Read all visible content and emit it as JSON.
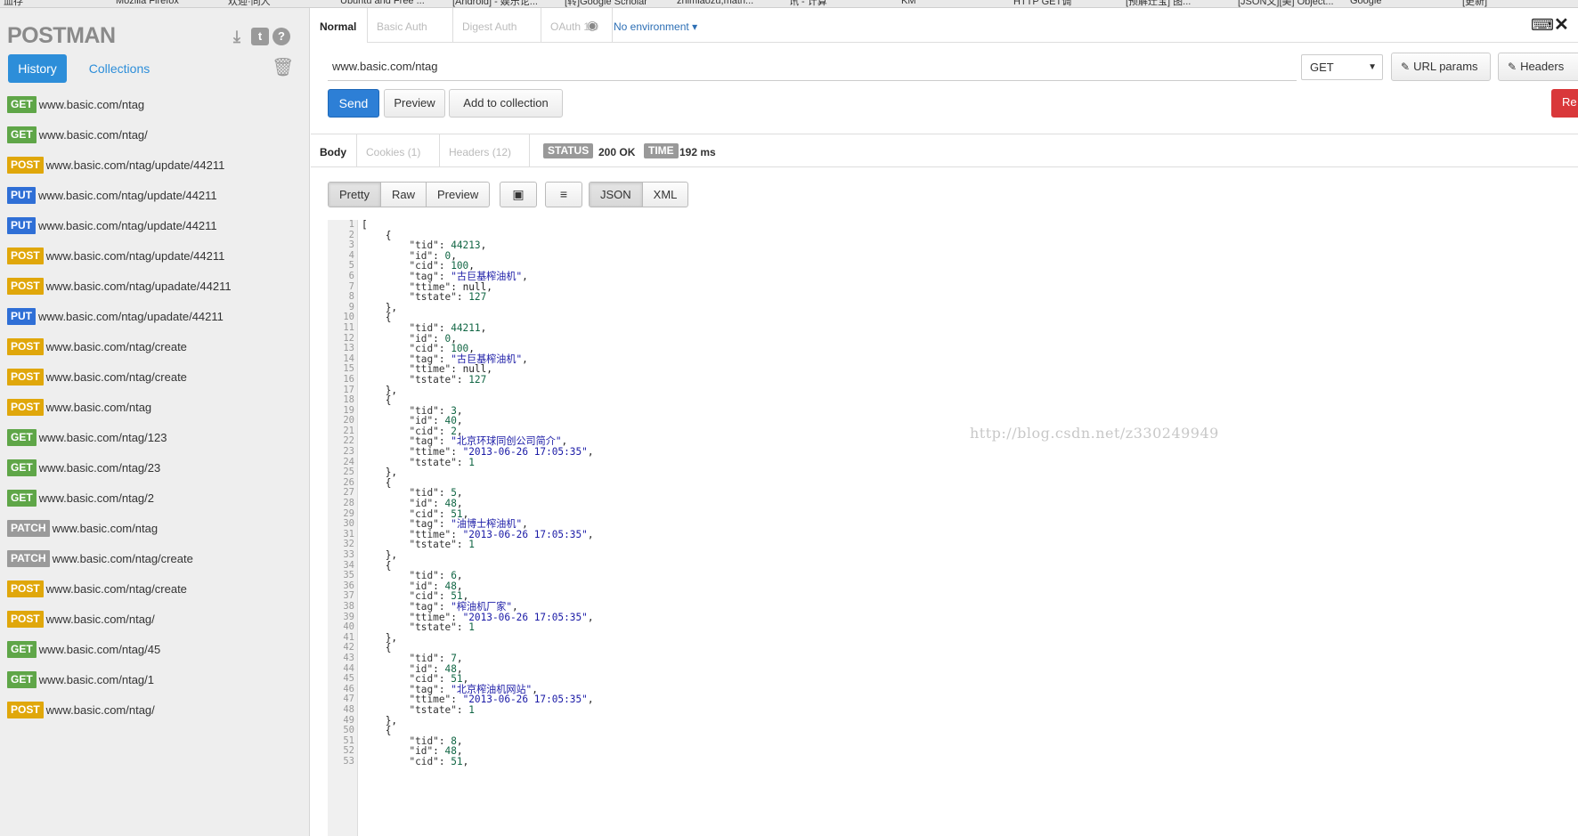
{
  "bookmarks": [
    "血存",
    "Mozilla Firefox",
    "欢迎·同人",
    "Ubuntu and Free ...",
    "[Android] - 娱乐论...",
    "[转]Google Scholar",
    "zhimiaozu,math...",
    "讯 - 计算",
    "KM",
    "HTTP GET调",
    "[预解迁宝] 图...",
    "[JSON文][美] Object...",
    "Google",
    "[更新]"
  ],
  "sidebar": {
    "logo": "POSTMAN",
    "tabs": {
      "history": "History",
      "collections": "Collections"
    },
    "history": [
      {
        "method": "GET",
        "url": "www.basic.com/ntag"
      },
      {
        "method": "GET",
        "url": "www.basic.com/ntag/"
      },
      {
        "method": "POST",
        "url": "www.basic.com/ntag/update/44211"
      },
      {
        "method": "PUT",
        "url": "www.basic.com/ntag/update/44211"
      },
      {
        "method": "PUT",
        "url": "www.basic.com/ntag/update/44211"
      },
      {
        "method": "POST",
        "url": "www.basic.com/ntag/update/44211"
      },
      {
        "method": "POST",
        "url": "www.basic.com/ntag/upadate/44211"
      },
      {
        "method": "PUT",
        "url": "www.basic.com/ntag/upadate/44211"
      },
      {
        "method": "POST",
        "url": "www.basic.com/ntag/create"
      },
      {
        "method": "POST",
        "url": "www.basic.com/ntag/create"
      },
      {
        "method": "POST",
        "url": "www.basic.com/ntag"
      },
      {
        "method": "GET",
        "url": "www.basic.com/ntag/123"
      },
      {
        "method": "GET",
        "url": "www.basic.com/ntag/23"
      },
      {
        "method": "GET",
        "url": "www.basic.com/ntag/2"
      },
      {
        "method": "PATCH",
        "url": "www.basic.com/ntag"
      },
      {
        "method": "PATCH",
        "url": "www.basic.com/ntag/create"
      },
      {
        "method": "POST",
        "url": "www.basic.com/ntag/create"
      },
      {
        "method": "POST",
        "url": "www.basic.com/ntag/"
      },
      {
        "method": "GET",
        "url": "www.basic.com/ntag/45"
      },
      {
        "method": "GET",
        "url": "www.basic.com/ntag/1"
      },
      {
        "method": "POST",
        "url": "www.basic.com/ntag/"
      }
    ]
  },
  "method_colors": {
    "GET": "#5fa648",
    "POST": "#e0a70b",
    "PUT": "#2f6fd6",
    "PATCH": "#9a9a9a"
  },
  "auth_tabs": {
    "normal": "Normal",
    "basic": "Basic Auth",
    "digest": "Digest Auth",
    "oauth": "OAuth 1.0"
  },
  "environment": "No environment",
  "request": {
    "url": "www.basic.com/ntag",
    "method": "GET",
    "url_params_label": "URL params",
    "headers_label": "Headers",
    "send_label": "Send",
    "preview_label": "Preview",
    "add_collection_label": "Add to collection",
    "reset_label": "Re"
  },
  "response": {
    "tabs": {
      "body": "Body",
      "cookies": "Cookies (1)",
      "headers": "Headers (12)"
    },
    "status_label": "STATUS",
    "status_value": "200 OK",
    "time_label": "TIME",
    "time_value": "192 ms",
    "view_modes": [
      "Pretty",
      "Raw",
      "Preview"
    ],
    "formats": [
      "JSON",
      "XML"
    ]
  },
  "code_lines": [
    "[",
    "    {",
    "        \"tid\": 44213,",
    "        \"id\": 0,",
    "        \"cid\": 100,",
    "        \"tag\": \"古巨基榨油机\",",
    "        \"ttime\": null,",
    "        \"tstate\": 127",
    "    },",
    "    {",
    "        \"tid\": 44211,",
    "        \"id\": 0,",
    "        \"cid\": 100,",
    "        \"tag\": \"古巨基榨油机\",",
    "        \"ttime\": null,",
    "        \"tstate\": 127",
    "    },",
    "    {",
    "        \"tid\": 3,",
    "        \"id\": 40,",
    "        \"cid\": 2,",
    "        \"tag\": \"北京环球同创公司简介\",",
    "        \"ttime\": \"2013-06-26 17:05:35\",",
    "        \"tstate\": 1",
    "    },",
    "    {",
    "        \"tid\": 5,",
    "        \"id\": 48,",
    "        \"cid\": 51,",
    "        \"tag\": \"油博士榨油机\",",
    "        \"ttime\": \"2013-06-26 17:05:35\",",
    "        \"tstate\": 1",
    "    },",
    "    {",
    "        \"tid\": 6,",
    "        \"id\": 48,",
    "        \"cid\": 51,",
    "        \"tag\": \"榨油机厂家\",",
    "        \"ttime\": \"2013-06-26 17:05:35\",",
    "        \"tstate\": 1",
    "    },",
    "    {",
    "        \"tid\": 7,",
    "        \"id\": 48,",
    "        \"cid\": 51,",
    "        \"tag\": \"北京榨油机网站\",",
    "        \"ttime\": \"2013-06-26 17:05:35\",",
    "        \"tstate\": 1",
    "    },",
    "    {",
    "        \"tid\": 8,",
    "        \"id\": 48,",
    "        \"cid\": 51,"
  ],
  "watermark": "http://blog.csdn.net/z330249949"
}
